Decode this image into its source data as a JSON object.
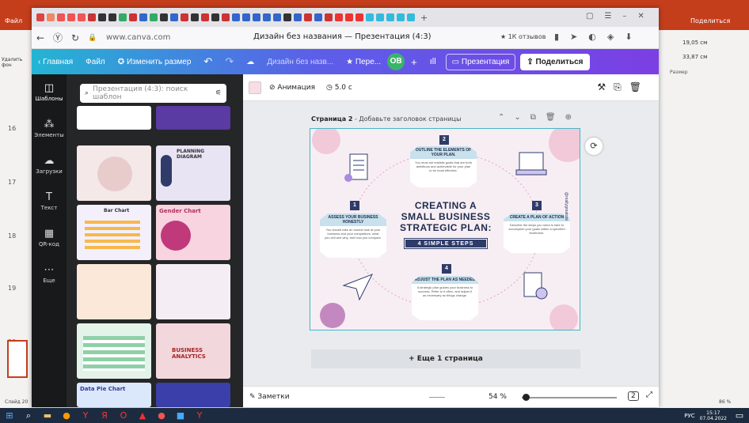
{
  "powerpoint": {
    "file_tab": "Файл",
    "share_label": "Поделиться",
    "delete_bg": "Удалить фон",
    "width": "19,05 см",
    "height": "33,87 см",
    "size_label": "Размер",
    "slide_status": "Слайд 20",
    "zoom": "86 %",
    "slide_numbers": [
      "16",
      "17",
      "18",
      "19",
      "20"
    ]
  },
  "browser": {
    "url": "www.canva.com",
    "page_title": "Дизайн без названия — Презентация (4:3)",
    "reviews": "1К отзывов"
  },
  "canva": {
    "home": "Главная",
    "file": "Файл",
    "resize": "Изменить размер",
    "design_name": "Дизайн без назв...",
    "transfer": "Пере...",
    "avatar": "OB",
    "present": "Презентация",
    "share": "Поделиться",
    "rail": [
      "Шаблоны",
      "Элементы",
      "Загрузки",
      "Текст",
      "QR-код",
      "Еще"
    ],
    "search_placeholder": "Презентация (4:3): поиск шаблон",
    "templates": [
      {
        "caption": ""
      },
      {
        "caption": ""
      },
      {
        "caption": ""
      },
      {
        "caption": "PLANNING DIAGRAM"
      },
      {
        "caption": "Bar Chart"
      },
      {
        "caption": "Gender Chart"
      },
      {
        "caption": ""
      },
      {
        "caption": ""
      },
      {
        "caption": ""
      },
      {
        "caption": "BUSINESS ANALYTICS"
      },
      {
        "caption": "Data Pie Chart"
      },
      {
        "caption": ""
      }
    ],
    "animation": "Анимация",
    "duration": "5.0 с",
    "page_label": "Страница 2",
    "page_hint": "- Добавьте заголовок страницы",
    "add_page": "+ Еще 1 страница",
    "notes": "Заметки",
    "zoom": "54 %",
    "page_count": "2"
  },
  "slide": {
    "title": "CREATING A SMALL BUSINESS STRATEGIC PLAN:",
    "badge": "4 SIMPLE STEPS",
    "handle": "@reallygreatsite",
    "steps": [
      {
        "num": "1",
        "title": "ASSESS YOUR BUSINESS HONESTLY",
        "text": "You should take an honest look at your business and your competitors, what you sell and why, and how you compare."
      },
      {
        "num": "2",
        "title": "OUTLINE THE ELEMENTS OF YOUR PLAN.",
        "text": "You must set realistic goals that are both ambitious and achievable for your plan to be most effective."
      },
      {
        "num": "3",
        "title": "CREATE A PLAN OF ACTION",
        "text": "Describe the steps you need to take to accomplish your goals within a specified timeframe."
      },
      {
        "num": "4",
        "title": "ADJUST THE PLAN AS NEEDED",
        "text": "A strategic plan guides your business to success. Refer to it often, and adjust it as necessary as things change."
      }
    ]
  },
  "taskbar": {
    "lang": "РУС",
    "time": "15:17",
    "date": "07.04.2022"
  }
}
